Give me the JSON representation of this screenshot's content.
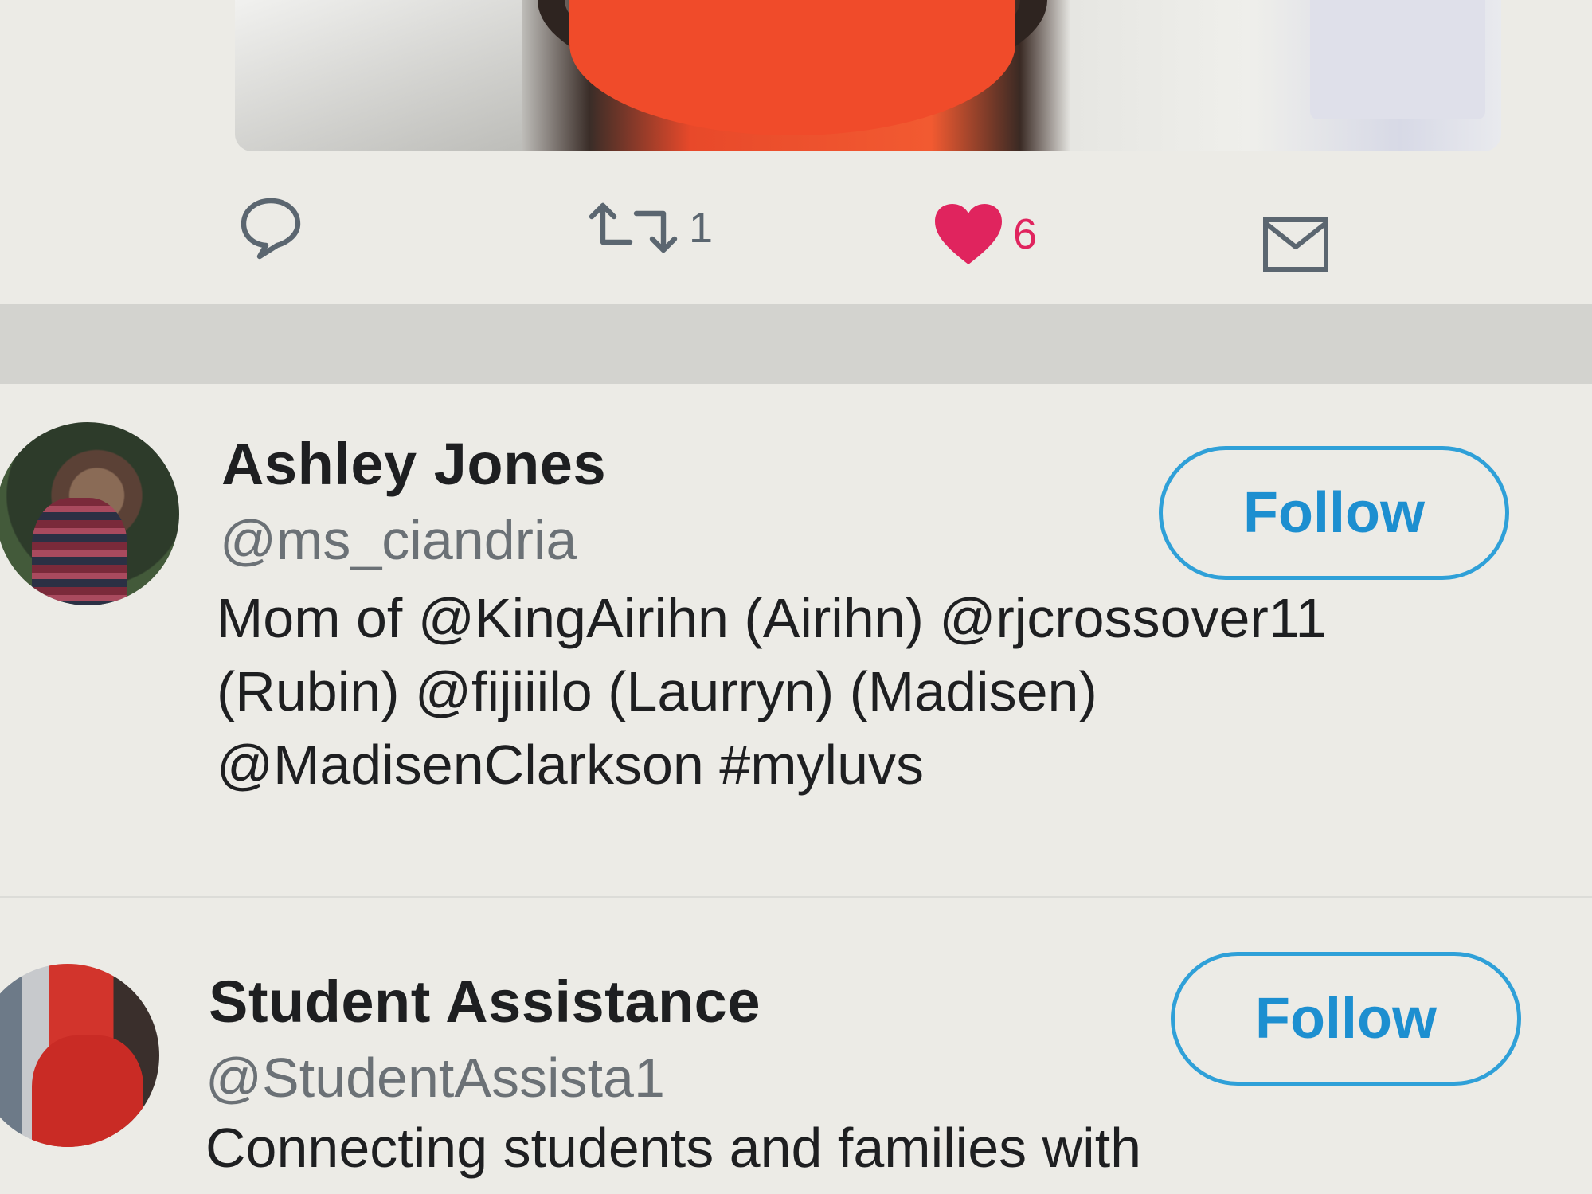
{
  "tweet": {
    "actions": {
      "reply_icon": "reply-icon",
      "retweet_icon": "retweet-icon",
      "retweet_count": "1",
      "like_icon": "heart-icon",
      "like_count": "6",
      "like_color": "#e0245e",
      "dm_icon": "envelope-icon"
    }
  },
  "users": [
    {
      "name": "Ashley Jones",
      "handle": "@ms_ciandria",
      "bio_lines": [
        "Mom of @KingAirihn (Airihn) @rjcrossover11",
        "(Rubin) @fijiiilo (Laurryn) (Madisen)",
        "@MadisenClarkson #myluvs"
      ],
      "follow_label": "Follow"
    },
    {
      "name": "Student Assistance",
      "handle": "@StudentAssista1",
      "bio_lines": [
        "Connecting students and families with"
      ],
      "follow_label": "Follow"
    }
  ],
  "colors": {
    "accent": "#1d8fd0",
    "background": "#ecebe6"
  }
}
